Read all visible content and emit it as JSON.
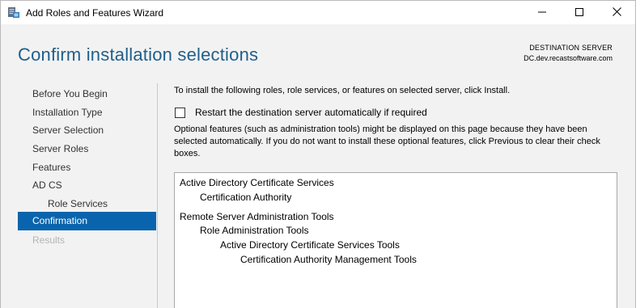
{
  "window": {
    "title": "Add Roles and Features Wizard",
    "app_icon": "server-manager-icon",
    "controls": [
      "minimize-icon",
      "maximize-icon",
      "close-icon"
    ]
  },
  "header": {
    "page_title": "Confirm installation selections",
    "destination_label": "DESTINATION SERVER",
    "destination_value": "DC.dev.recastsoftware.com"
  },
  "nav": {
    "items": [
      {
        "label": "Before You Begin",
        "state": "normal"
      },
      {
        "label": "Installation Type",
        "state": "normal"
      },
      {
        "label": "Server Selection",
        "state": "normal"
      },
      {
        "label": "Server Roles",
        "state": "normal"
      },
      {
        "label": "Features",
        "state": "normal"
      },
      {
        "label": "AD CS",
        "state": "normal"
      },
      {
        "label": "Role Services",
        "state": "normal"
      },
      {
        "label": "Confirmation",
        "state": "active"
      },
      {
        "label": "Results",
        "state": "disabled"
      }
    ]
  },
  "content": {
    "intro": "To install the following roles, role services, or features on selected server, click Install.",
    "restart_checkbox": {
      "label": "Restart the destination server automatically if required",
      "checked": false
    },
    "optional_text": "Optional features (such as administration tools) might be displayed on this page because they have been selected automatically. If you do not want to install these optional features, click Previous to clear their check boxes.",
    "selections": [
      {
        "label": "Active Directory Certificate Services"
      },
      {
        "label": "Certification Authority"
      },
      {
        "label": "Remote Server Administration Tools"
      },
      {
        "label": "Role Administration Tools"
      },
      {
        "label": "Active Directory Certificate Services Tools"
      },
      {
        "label": "Certification Authority Management Tools"
      }
    ]
  },
  "colors": {
    "title_blue": "#1f5f8b",
    "nav_active_bg": "#0a64ad",
    "panel_bg": "#f2f2f2",
    "disabled_text": "#b5b5b5"
  }
}
